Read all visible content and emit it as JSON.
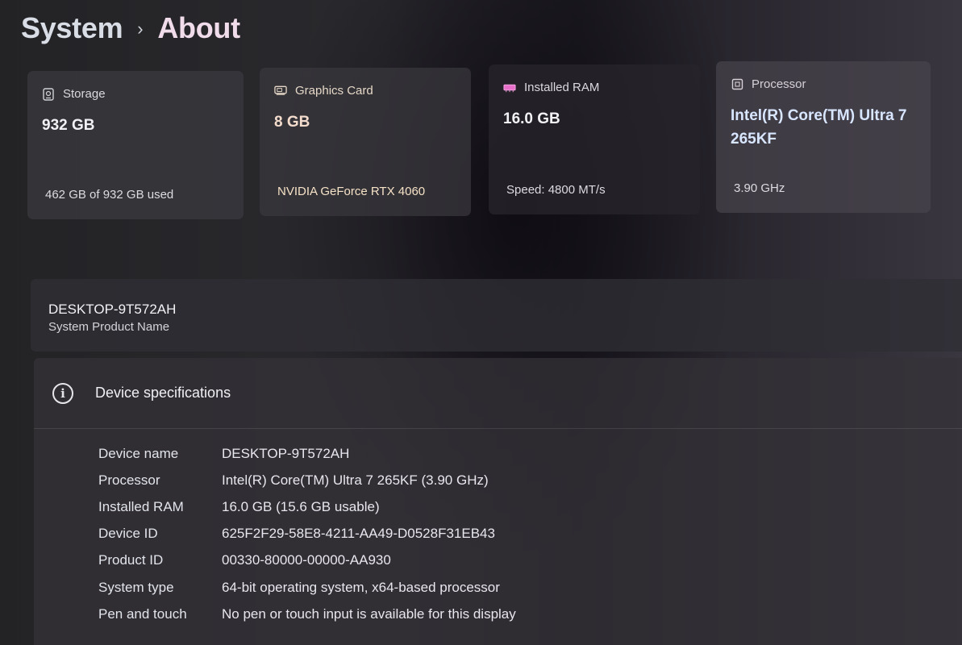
{
  "breadcrumb": {
    "parent": "System",
    "separator": "›",
    "current": "About"
  },
  "cards": {
    "storage": {
      "icon": "storage-icon",
      "label": "Storage",
      "value": "932 GB",
      "sub": "462 GB of 932 GB used"
    },
    "gpu": {
      "icon": "graphics-card-icon",
      "label": "Graphics Card",
      "value": "8 GB",
      "sub": "NVIDIA GeForce RTX 4060"
    },
    "ram": {
      "icon": "ram-icon",
      "label": "Installed RAM",
      "value": "16.0 GB",
      "sub": "Speed: 4800 MT/s"
    },
    "cpu": {
      "icon": "processor-icon",
      "label": "Processor",
      "value": "Intel(R) Core(TM) Ultra 7 265KF",
      "sub": "3.90 GHz"
    }
  },
  "device": {
    "name": "DESKTOP-9T572AH",
    "caption": "System Product Name"
  },
  "specs": {
    "title": "Device specifications",
    "rows": [
      {
        "key": "Device name",
        "value": "DESKTOP-9T572AH"
      },
      {
        "key": "Processor",
        "value": "Intel(R) Core(TM) Ultra 7 265KF (3.90 GHz)"
      },
      {
        "key": "Installed RAM",
        "value": "16.0 GB (15.6 GB usable)"
      },
      {
        "key": "Device ID",
        "value": "625F2F29-58E8-4211-AA49-D0528F31EB43"
      },
      {
        "key": "Product ID",
        "value": "00330-80000-00000-AA930"
      },
      {
        "key": "System type",
        "value": "64-bit operating system, x64-based processor"
      },
      {
        "key": "Pen and touch",
        "value": "No pen or touch input is available for this display"
      }
    ]
  }
}
